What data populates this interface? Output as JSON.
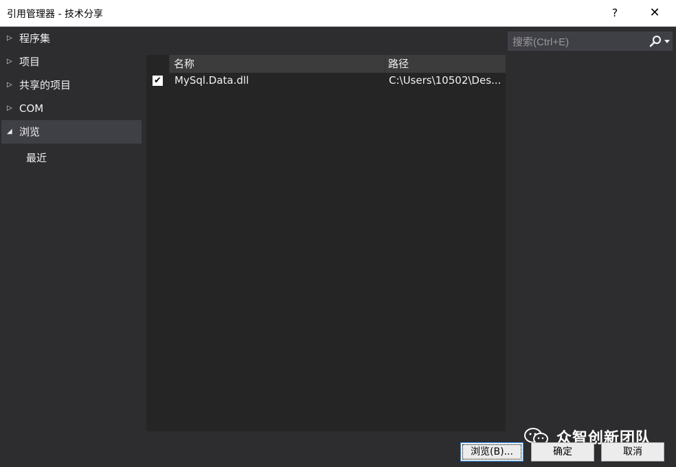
{
  "window": {
    "title": "引用管理器 - 技术分享",
    "help_label": "?",
    "close_label": "✕"
  },
  "sidebar": {
    "items": [
      {
        "label": "程序集",
        "arrow": "▷"
      },
      {
        "label": "项目",
        "arrow": "▷"
      },
      {
        "label": "共享的项目",
        "arrow": "▷"
      },
      {
        "label": "COM",
        "arrow": "▷"
      },
      {
        "label": "浏览",
        "arrow": "◢",
        "selected": true
      }
    ],
    "sub_item": "最近"
  },
  "list": {
    "columns": [
      "名称",
      "路径"
    ],
    "rows": [
      {
        "checked": true,
        "check_mark": "✔",
        "name": "MySql.Data.dll",
        "path": "C:\\Users\\10502\\Des..."
      }
    ]
  },
  "search": {
    "placeholder": "搜索(Ctrl+E)",
    "value": ""
  },
  "buttons": {
    "browse_label": "浏览(B)...",
    "ok_label": "确定",
    "cancel_label": "取消"
  },
  "watermark": {
    "text": "众智创新团队"
  },
  "colors": {
    "background": "#2d2d30",
    "list_background": "#252526",
    "selected_nav": "#3f3f46",
    "titlebar": "#ffffff"
  }
}
